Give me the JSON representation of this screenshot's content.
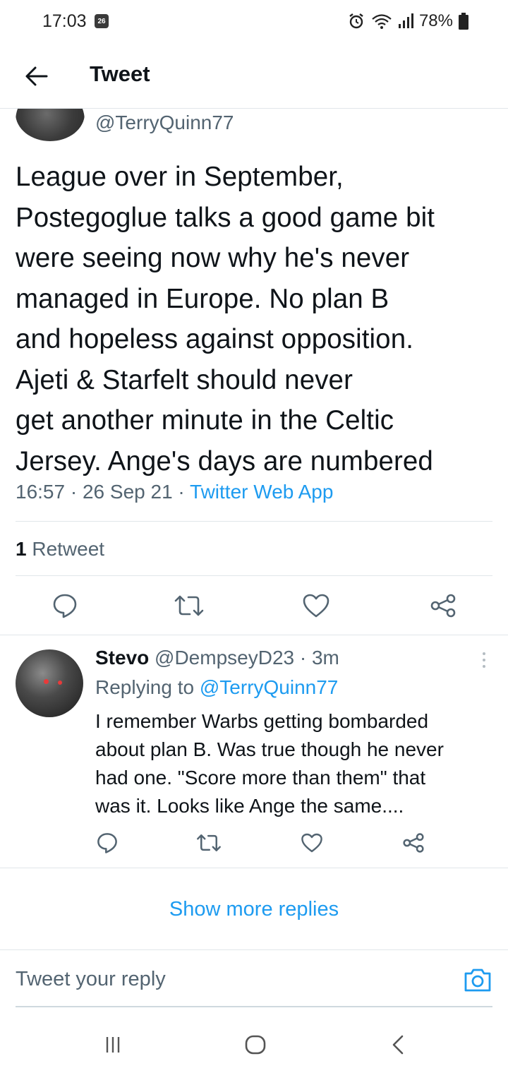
{
  "status_bar": {
    "time": "17:03",
    "calendar_day": "26",
    "battery": "78%"
  },
  "header": {
    "title": "Tweet"
  },
  "main_tweet": {
    "handle": "@TerryQuinn77",
    "text": "League over in September,\nPostegoglue talks a good game bit\nwere seeing now why he's never\nmanaged in Europe. No plan B\nand hopeless against opposition.\nAjeti & Starfelt should never\nget another minute in the Celtic\nJersey. Ange's days are numbered",
    "time": "16:57",
    "date": "26 Sep 21",
    "source": "Twitter Web App",
    "retweet_count": "1",
    "retweet_label": "Retweet"
  },
  "reply": {
    "name": "Stevo",
    "handle": "@DempseyD23",
    "age": "3m",
    "replying_to_label": "Replying to",
    "replying_to_handle": "@TerryQuinn77",
    "text": "I remember Warbs getting bombarded\nabout plan B. Was true though he never\nhad one. \"Score more than them\" that\nwas it. Looks like Ange the same...."
  },
  "show_more_label": "Show more replies",
  "composer": {
    "placeholder": "Tweet your reply"
  },
  "colors": {
    "accent": "#1d9bf0",
    "secondary_text": "#536471",
    "primary_text": "#0f1419",
    "divider": "#e1e6ea"
  },
  "icons": {
    "back": "arrow-left-icon",
    "reply": "comment-icon",
    "retweet": "retweet-icon",
    "like": "heart-icon",
    "share": "share-icon",
    "camera": "camera-icon",
    "nav_recents": "recents-icon",
    "nav_home": "home-icon",
    "nav_back": "nav-back-icon"
  }
}
